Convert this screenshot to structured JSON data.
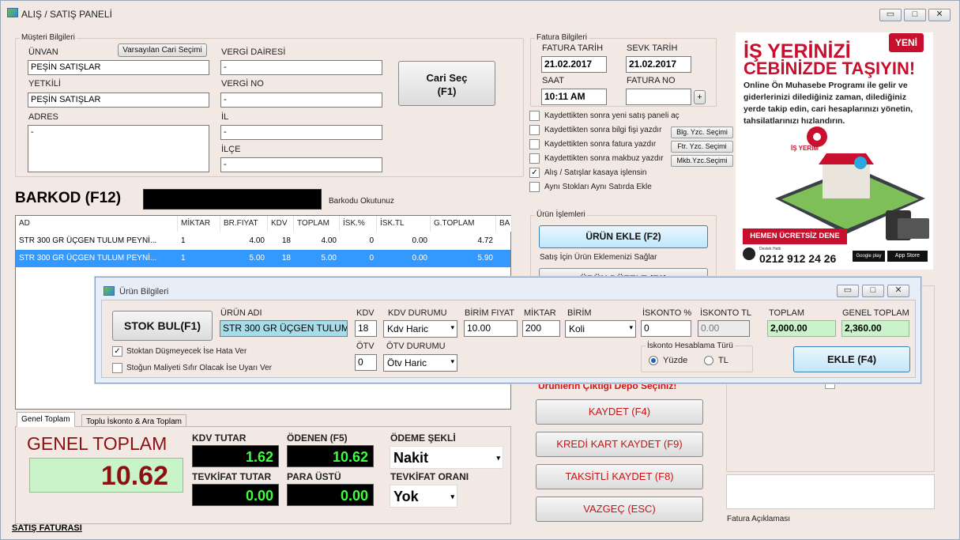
{
  "window": {
    "title": "ALIŞ / SATIŞ PANELİ",
    "min": "▭",
    "max": "□",
    "close": "✕"
  },
  "customer": {
    "group_title": "Müşteri Bilgileri",
    "unvan_label": "ÜNVAN",
    "unvan_value": "PEŞİN SATIŞLAR",
    "default_btn": "Varsayılan Cari Seçimi",
    "yetkili_label": "YETKİLİ",
    "yetkili_value": "PEŞİN SATIŞLAR",
    "adres_label": "ADRES",
    "adres_value": "-",
    "vergi_dairesi_label": "VERGİ DAİRESİ",
    "vergi_dairesi_value": "-",
    "vergi_no_label": "VERGİ NO",
    "vergi_no_value": "-",
    "il_label": "İL",
    "il_value": "-",
    "ilce_label": "İLÇE",
    "ilce_value": "-",
    "cari_sec_btn": "Cari Seç",
    "cari_sec_key": "(F1)"
  },
  "invoice": {
    "group_title": "Fatura Bilgileri",
    "fatura_tarih_label": "FATURA TARİH",
    "fatura_tarih": "21.02.2017",
    "sevk_tarih_label": "SEVK TARİH",
    "sevk_tarih": "21.02.2017",
    "saat_label": "SAAT",
    "saat": "10:11 AM",
    "fatura_no_label": "FATURA NO",
    "fatura_no": "",
    "plus": "+"
  },
  "options": [
    {
      "label": "Kaydettikten sonra yeni satış paneli aç",
      "checked": false,
      "btn": ""
    },
    {
      "label": "Kaydettikten sonra bilgi fişi yazdır",
      "checked": false,
      "btn": "Blg. Yzc. Seçimi"
    },
    {
      "label": "Kaydettikten sonra fatura yazdır",
      "checked": false,
      "btn": "Ftr. Yzc. Seçimi"
    },
    {
      "label": "Kaydettikten sonra makbuz yazdır",
      "checked": false,
      "btn": "Mkb.Yzc.Seçimi"
    },
    {
      "label": "Alış / Satışlar kasaya işlensin",
      "checked": true,
      "btn": ""
    },
    {
      "label": "Aynı Stokları Aynı Satırda Ekle",
      "checked": false,
      "btn": ""
    }
  ],
  "barcode": {
    "label": "BARKOD (F12)",
    "value": "",
    "hint": "Barkodu Okutunuz"
  },
  "grid": {
    "headers": [
      "AD",
      "MİKTAR",
      "BR.FIYAT",
      "KDV",
      "TOPLAM",
      "İSK.%",
      "İSK.TL",
      "G.TOPLAM",
      "BA"
    ],
    "rows": [
      [
        "STR 300 GR ÜÇGEN TULUM PEYNİ...",
        "1",
        "4.00",
        "18",
        "4.00",
        "0",
        "0.00",
        "4.72"
      ],
      [
        "STR 300 GR ÜÇGEN TULUM PEYNİ...",
        "1",
        "5.00",
        "18",
        "5.00",
        "0",
        "0.00",
        "5.90"
      ]
    ]
  },
  "product_ops": {
    "group_title": "Ürün İşlemleri",
    "add_btn": "ÜRÜN EKLE (F2)",
    "add_hint": "Satış İçin Ürün Eklemenizi Sağlar",
    "edit_btn": "ÜRÜN DÜZELT (F3)",
    "depot_warning": "Ürünlerin Çıktığı Depo Seçiniz!"
  },
  "actions": {
    "save": "KAYDET (F4)",
    "card_save": "KREDİ KART KAYDET (F9)",
    "installment_save": "TAKSİTLİ KAYDET (F8)",
    "cancel": "VAZGEÇ (ESC)"
  },
  "totals": {
    "tab1": "Genel Toplam",
    "tab2": "Toplu İskonto & Ara Toplam",
    "genel_toplam_label": "GENEL TOPLAM",
    "genel_toplam": "10.62",
    "kdv_tutar_label": "KDV TUTAR",
    "kdv_tutar": "1.62",
    "odenen_label": "ÖDENEN (F5)",
    "odenen": "10.62",
    "odeme_sekli_label": "ÖDEME ŞEKLİ",
    "odeme_sekli": "Nakit",
    "tevkifat_tutar_label": "TEVKİFAT TUTAR",
    "tevkifat_tutar": "0.00",
    "para_ustu_label": "PARA ÜSTÜ",
    "para_ustu": "0.00",
    "tevkifat_orani_label": "TEVKİFAT ORANI",
    "tevkifat_orani": "Yok"
  },
  "footer": {
    "satis_faturasi": "SATIŞ FATURASI",
    "fatura_aciklamasi": "Fatura Açıklaması"
  },
  "ad": {
    "badge": "YENİ",
    "headline1": "İŞ YERİNİZİ",
    "headline2": "CEBİNİZDE TAŞIYIN!",
    "body": "Online Ön Muhasebe Programı ile gelir ve giderlerinizi dilediğiniz zaman, dilediğiniz yerde takip edin, cari hesaplarınızı yönetin, tahsilatlarınızı hızlandırın.",
    "brand": "İŞ YERİM",
    "cta": "HEMEN ÜCRETSİZ DENE",
    "phone_caption": "Destek Hattı",
    "phone": "0212 912 24 26",
    "google_play": "Google play",
    "app_store": "App Store",
    "accent": "#c8102e"
  },
  "dialog": {
    "title": "Ürün Bilgileri",
    "stok_bul": "STOK BUL(F1)",
    "urun_adi_label": "ÜRÜN ADI",
    "urun_adi": "STR 300 GR ÜÇGEN TULUM",
    "kdv_label": "KDV",
    "kdv": "18",
    "kdv_durumu_label": "KDV DURUMU",
    "kdv_durumu": "Kdv Haric",
    "birim_fiyat_label": "BİRİM FIYAT",
    "birim_fiyat": "10.00",
    "miktar_label": "MİKTAR",
    "miktar": "200",
    "birim_label": "BİRİM",
    "birim": "Koli",
    "iskonto_pct_label": "İSKONTO %",
    "iskonto_pct": "0",
    "iskonto_tl_label": "İSKONTO TL",
    "iskonto_tl": "0.00",
    "toplam_label": "TOPLAM",
    "toplam": "2,000.00",
    "genel_toplam_label": "GENEL TOPLAM",
    "genel_toplam": "2,360.00",
    "otv_label": "ÖTV",
    "otv": "0",
    "otv_durumu_label": "ÖTV DURUMU",
    "otv_durumu": "Ötv Haric",
    "chk1": "Stoktan Düşmeyecek İse Hata Ver",
    "chk1_checked": true,
    "chk2": "Stoğun Maliyeti Sıfır Olacak İse Uyarı Ver",
    "chk2_checked": false,
    "iskonto_group": "İskonto Hesablama Türü",
    "radio_yuzde": "Yüzde",
    "radio_tl": "TL",
    "ekle_btn": "EKLE (F4)"
  }
}
